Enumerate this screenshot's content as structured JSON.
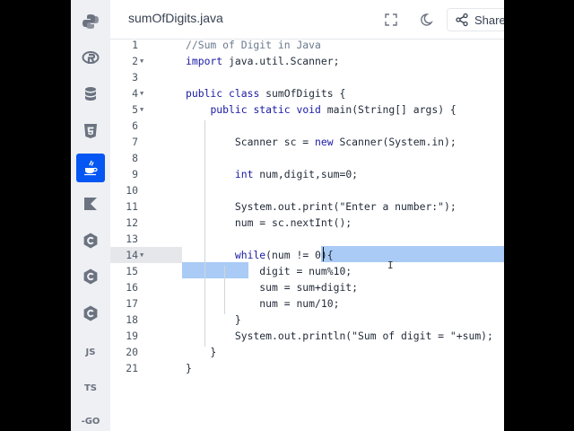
{
  "header": {
    "file_name": "sumOfDigits.java",
    "share_label": "Share"
  },
  "rail": {
    "items": [
      {
        "name": "python",
        "icon": "python-icon"
      },
      {
        "name": "r",
        "icon": "r-icon"
      },
      {
        "name": "sql",
        "icon": "database-icon"
      },
      {
        "name": "html",
        "icon": "html5-icon"
      },
      {
        "name": "java",
        "icon": "java-icon",
        "active": true
      },
      {
        "name": "kotlin",
        "icon": "kotlin-icon"
      },
      {
        "name": "c",
        "icon": "c-icon"
      },
      {
        "name": "cpp",
        "icon": "cpp-icon"
      },
      {
        "name": "csharp",
        "icon": "csharp-icon"
      },
      {
        "name": "javascript",
        "label": "JS"
      },
      {
        "name": "typescript",
        "label": "TS"
      },
      {
        "name": "go",
        "label": "-GO"
      }
    ]
  },
  "editor": {
    "lines": [
      {
        "n": "1",
        "text": "//Sum of Digit in Java"
      },
      {
        "n": "2",
        "text": "import java.util.Scanner;"
      },
      {
        "n": "3",
        "text": ""
      },
      {
        "n": "4",
        "text": "public class sumOfDigits {"
      },
      {
        "n": "5",
        "text": "    public static void main(String[] args) {"
      },
      {
        "n": "6",
        "text": ""
      },
      {
        "n": "7",
        "text": "        Scanner sc = new Scanner(System.in);"
      },
      {
        "n": "8",
        "text": ""
      },
      {
        "n": "9",
        "text": "        int num,digit,sum=0;"
      },
      {
        "n": "10",
        "text": ""
      },
      {
        "n": "11",
        "text": "        System.out.print(\"Enter a number:\");"
      },
      {
        "n": "12",
        "text": "        num = sc.nextInt();"
      },
      {
        "n": "13",
        "text": ""
      },
      {
        "n": "14",
        "text": "        while(num != 0){"
      },
      {
        "n": "15",
        "text": "            digit = num%10;"
      },
      {
        "n": "16",
        "text": "            sum = sum+digit;"
      },
      {
        "n": "17",
        "text": "            num = num/10;"
      },
      {
        "n": "18",
        "text": "        }"
      },
      {
        "n": "19",
        "text": "        System.out.println(\"Sum of digit = \"+sum);"
      },
      {
        "n": "20",
        "text": "    }"
      },
      {
        "n": "21",
        "text": "}"
      }
    ],
    "current_line": "14",
    "fold_lines": [
      "2",
      "4",
      "5",
      "14"
    ]
  },
  "colors": {
    "accent": "#0556f3",
    "selection": "#a9cbf5",
    "keyword": "#1a1aa6"
  }
}
